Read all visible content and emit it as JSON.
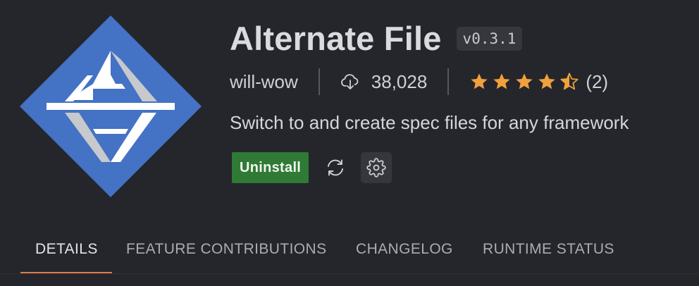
{
  "extension": {
    "name": "Alternate File",
    "version": "v0.3.1",
    "publisher": "will-wow",
    "installs": "38,028",
    "rating_stars": 4.5,
    "rating_count": "(2)",
    "description": "Switch to and create spec files for any framework"
  },
  "actions": {
    "uninstall_label": "Uninstall"
  },
  "tabs": [
    {
      "label": "DETAILS",
      "active": true
    },
    {
      "label": "FEATURE CONTRIBUTIONS",
      "active": false
    },
    {
      "label": "CHANGELOG",
      "active": false
    },
    {
      "label": "RUNTIME STATUS",
      "active": false
    }
  ],
  "colors": {
    "background": "#24262b",
    "logo_blue": "#4472c4",
    "star": "#f0a03c",
    "uninstall_green": "#2f7a35",
    "tab_underline": "#e07a45"
  },
  "icons": [
    "download-cloud-icon",
    "star-icon",
    "sync-icon",
    "gear-icon"
  ]
}
